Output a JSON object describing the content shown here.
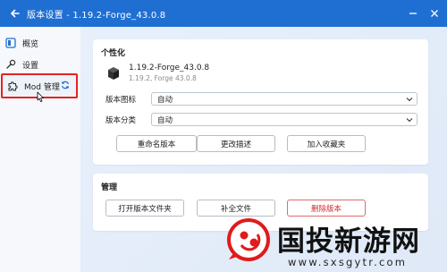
{
  "window": {
    "title": "版本设置 - 1.19.2-Forge_43.0.8",
    "accent": "#1f6fd3"
  },
  "sidebar": {
    "items": [
      {
        "label": "概览",
        "icon": "overview-icon"
      },
      {
        "label": "设置",
        "icon": "wrench-icon"
      },
      {
        "label": "Mod 管理",
        "icon": "puzzle-icon",
        "action_icon": "refresh-icon"
      }
    ]
  },
  "personal": {
    "title": "个性化",
    "version_name": "1.19.2-Forge_43.0.8",
    "version_sub": "1.19.2, Forge 43.0.8",
    "icon_label": "版本图标",
    "icon_value": "自动",
    "category_label": "版本分类",
    "category_value": "自动",
    "buttons": [
      "重命名版本",
      "更改描述",
      "加入收藏夹"
    ]
  },
  "manage": {
    "title": "管理",
    "buttons": [
      "打开版本文件夹",
      "补全文件",
      "删除版本"
    ],
    "danger_color": "#d62828"
  },
  "watermark": {
    "text": "国投新游网",
    "url": "www.sxsgytr.com"
  }
}
